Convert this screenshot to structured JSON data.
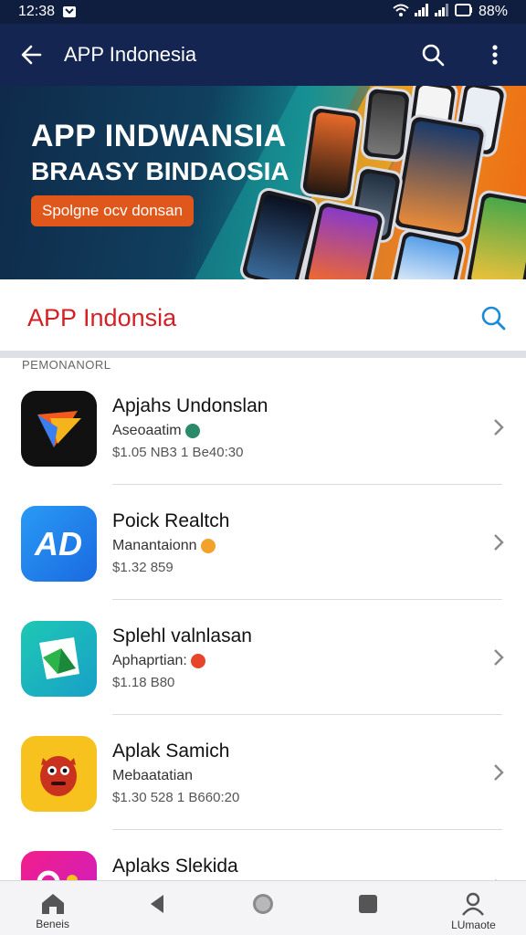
{
  "status_bar": {
    "time": "12:38",
    "battery": "88%"
  },
  "app_bar": {
    "title": "APP Indonesia"
  },
  "banner": {
    "headline": "APP INDWANSIA",
    "subheadline": "BRAASY BINDAOSIA",
    "cta_label": "Spolgne ocv donsan"
  },
  "section": {
    "title": "APP Indonsia",
    "sublabel": "PEMONANORL"
  },
  "apps": [
    {
      "name": "Apjahs Undonslan",
      "category": "Aseoaatim",
      "meta": "$1.05 NB3  1 Be40:30",
      "icon": "arrow-logo-icon"
    },
    {
      "name": "Poick Realtch",
      "category": "Manantaionn",
      "meta": "$1.32 859",
      "icon": "ad-logo-icon"
    },
    {
      "name": "Splehl valnlasan",
      "category": "Aphaprtian:",
      "meta": "$1.18 B80",
      "icon": "paper-logo-icon"
    },
    {
      "name": "Aplak Samich",
      "category": "Mebaatatian",
      "meta": "$1.30 528  1 B660:20",
      "icon": "monster-logo-icon"
    },
    {
      "name": "Aplaks Slekida",
      "category": "",
      "meta": "",
      "icon": "pink-logo-icon"
    }
  ],
  "bottom_nav": [
    {
      "label": "Beneis",
      "icon": "home-icon"
    },
    {
      "label": "",
      "icon": "back-triangle-icon"
    },
    {
      "label": "",
      "icon": "home-circle-icon"
    },
    {
      "label": "",
      "icon": "recents-square-icon"
    },
    {
      "label": "LUmaote",
      "icon": "profile-icon"
    }
  ],
  "colors": {
    "app_bar": "#142552",
    "accent_red": "#d32026",
    "search_blue": "#1a8ad6"
  }
}
